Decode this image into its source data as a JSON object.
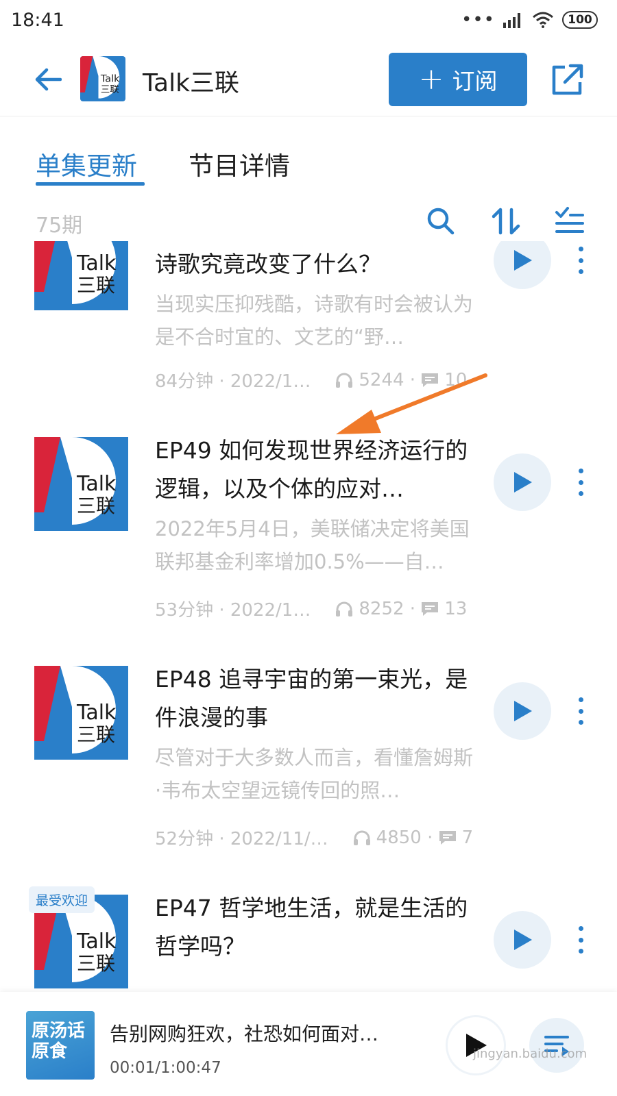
{
  "status_bar": {
    "time": "18:41",
    "battery": "100"
  },
  "header": {
    "title": "Talk三联",
    "subscribe_label": "订阅"
  },
  "tabs": [
    {
      "label": "单集更新"
    },
    {
      "label": "节目详情"
    }
  ],
  "list_toolbar": {
    "count": "75期"
  },
  "cover_art": {
    "line1": "Talk",
    "line2": "三联"
  },
  "episodes": [
    {
      "title": "诗歌究竟改变了什么？",
      "desc": "当现实压抑残酷，诗歌有时会被认为是不合时宜的、文艺的“野…",
      "duration_date": "84分钟 · 2022/1…",
      "plays": "5244",
      "comments": "10"
    },
    {
      "title": "EP49 如何发现世界经济运行的逻辑，以及个体的应对…",
      "desc": "2022年5月4日，美联储决定将美国联邦基金利率增加0.5%——自…",
      "duration_date": "53分钟 · 2022/1…",
      "plays": "8252",
      "comments": "13"
    },
    {
      "title": "EP48 追寻宇宙的第一束光，是件浪漫的事",
      "desc": "尽管对于大多数人而言，看懂詹姆斯·韦布太空望远镜传回的照…",
      "duration_date": "52分钟 · 2022/11/…",
      "plays": "4850",
      "comments": "7"
    },
    {
      "title": "EP47 哲学地生活，就是生活的哲学吗？",
      "badge": "最受欢迎"
    }
  ],
  "mini_player": {
    "title": "告别网购狂欢，社恐如何面对…",
    "time": "00:01/1:00:47",
    "cover_text": "原汤话原食"
  },
  "watermark": "jingyan.baidu.com",
  "colors": {
    "accent": "#2a7fc9",
    "arrow": "#f07a2a",
    "cover_red": "#d9243a"
  }
}
